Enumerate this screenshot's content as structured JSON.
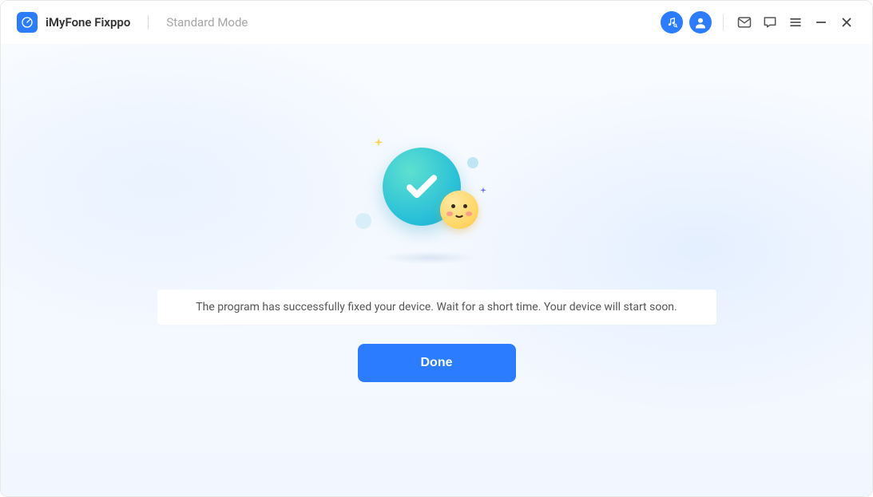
{
  "header": {
    "app_title": "iMyFone Fixppo",
    "mode_label": "Standard Mode"
  },
  "main": {
    "status_message": "The program has successfully fixed your device. Wait for a short time. Your device will start soon.",
    "done_label": "Done"
  },
  "icons": {
    "music_search": "music-search-icon",
    "account": "account-icon",
    "mail": "mail-icon",
    "chat": "chat-icon",
    "menu": "menu-icon",
    "minimize": "minimize-icon",
    "close": "close-icon"
  },
  "colors": {
    "primary": "#2b7cff",
    "teal": "#29c0d8",
    "muted_text": "#a6a6a6"
  }
}
